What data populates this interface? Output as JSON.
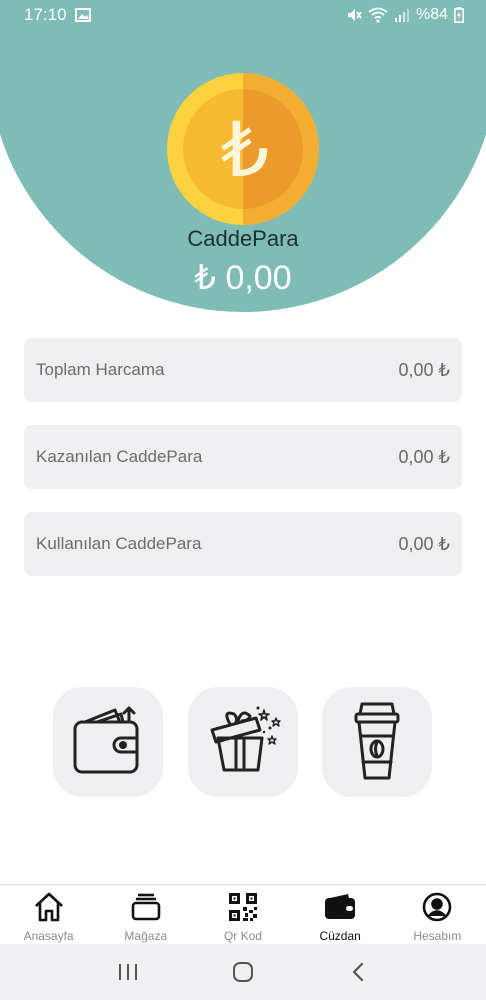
{
  "status_bar": {
    "time": "17:10",
    "battery": "%84"
  },
  "header": {
    "brand_name": "CaddePara",
    "balance": "₺ 0,00",
    "coin_symbol": "₺"
  },
  "stats": [
    {
      "label": "Toplam Harcama",
      "value": "0,00 ₺"
    },
    {
      "label": "Kazanılan CaddePara",
      "value": "0,00 ₺"
    },
    {
      "label": "Kullanılan CaddePara",
      "value": "0,00 ₺"
    }
  ],
  "actions": [
    {
      "icon": "wallet-topup-icon"
    },
    {
      "icon": "gift-box-icon"
    },
    {
      "icon": "coffee-cup-icon"
    }
  ],
  "bottom_nav": [
    {
      "label": "Anasayfa",
      "icon": "home-icon"
    },
    {
      "label": "Mağaza",
      "icon": "store-icon"
    },
    {
      "label": "Qr Kod",
      "icon": "qr-code-icon"
    },
    {
      "label": "Cüzdan",
      "icon": "wallet-icon",
      "active": true
    },
    {
      "label": "Hesabım",
      "icon": "account-icon"
    }
  ],
  "colors": {
    "header": "#7fbcb6",
    "coin_light": "#fcd23f",
    "coin_dark": "#eb9a2c",
    "card": "#efeef0"
  }
}
